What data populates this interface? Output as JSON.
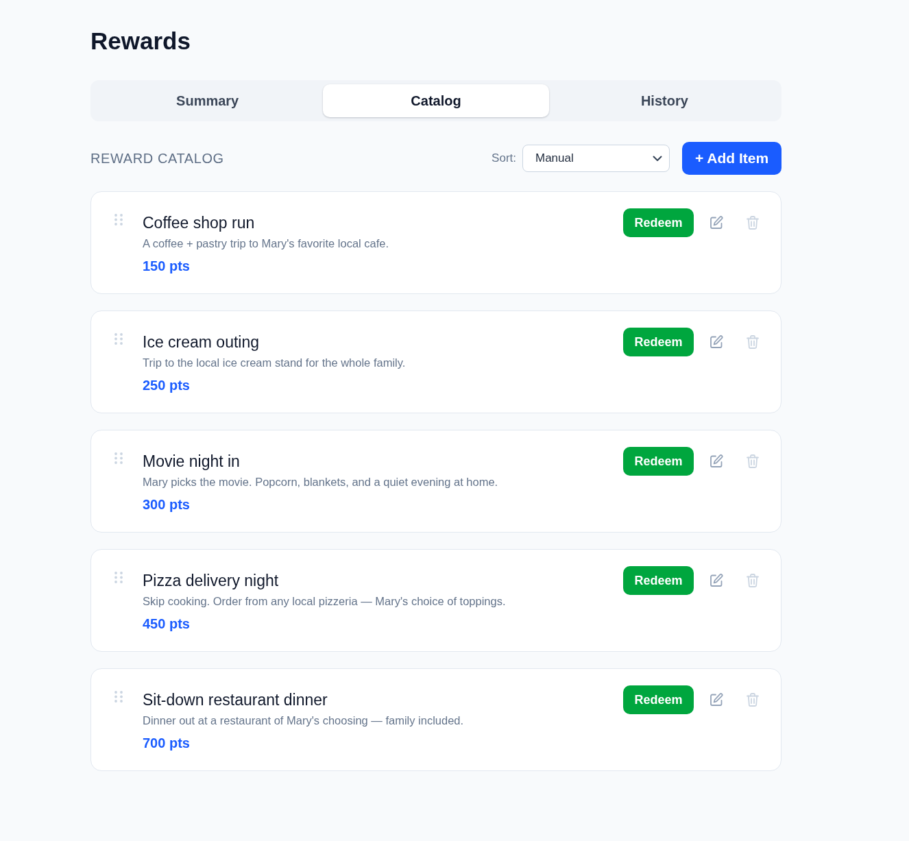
{
  "page": {
    "title": "Rewards"
  },
  "tabs": [
    {
      "label": "Summary",
      "selected": false
    },
    {
      "label": "Catalog",
      "selected": true
    },
    {
      "label": "History",
      "selected": false
    }
  ],
  "catalog": {
    "heading": "REWARD CATALOG",
    "sort": {
      "label": "Sort:",
      "value": "Manual"
    },
    "add_button": "+ Add Item",
    "items": [
      {
        "title": "Coffee shop run",
        "description": "A coffee + pastry trip to Mary's favorite local cafe.",
        "points": "150 pts",
        "redeem": "Redeem"
      },
      {
        "title": "Ice cream outing",
        "description": "Trip to the local ice cream stand for the whole family.",
        "points": "250 pts",
        "redeem": "Redeem"
      },
      {
        "title": "Movie night in",
        "description": "Mary picks the movie. Popcorn, blankets, and a quiet evening at home.",
        "points": "300 pts",
        "redeem": "Redeem"
      },
      {
        "title": "Pizza delivery night",
        "description": "Skip cooking. Order from any local pizzeria — Mary's choice of toppings.",
        "points": "450 pts",
        "redeem": "Redeem"
      },
      {
        "title": "Sit-down restaurant dinner",
        "description": "Dinner out at a restaurant of Mary's choosing — family included.",
        "points": "700 pts",
        "redeem": "Redeem"
      }
    ]
  }
}
